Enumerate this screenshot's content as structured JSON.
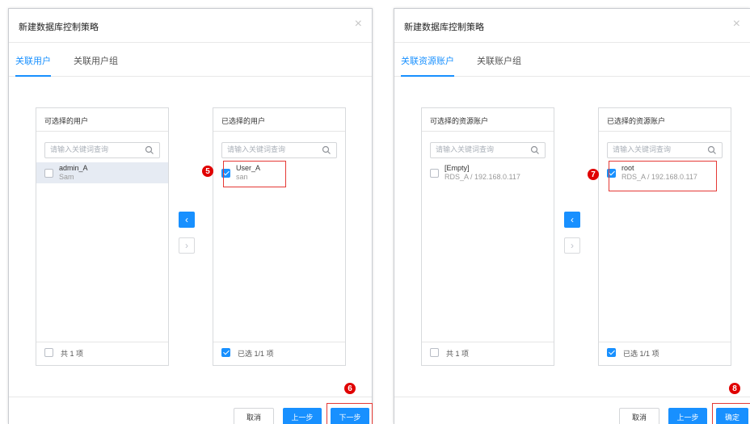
{
  "dialogs": [
    {
      "title": "新建数据库控制策略",
      "close_symbol": "×",
      "tabs": [
        {
          "label": "关联用户",
          "active": true
        },
        {
          "label": "关联用户组",
          "active": false
        }
      ],
      "source_panel": {
        "title": "可选择的用户",
        "search_placeholder": "请输入关键词查询",
        "items": [
          {
            "name": "admin_A",
            "sub": "Sam",
            "checked": false
          }
        ],
        "footer": "共 1 项"
      },
      "target_panel": {
        "title": "已选择的用户",
        "search_placeholder": "请输入关键词查询",
        "items": [
          {
            "name": "User_A",
            "sub": "san",
            "checked": true
          }
        ],
        "footer": "已选 1/1 项"
      },
      "transfer_buttons": {
        "left": "‹",
        "right": "›"
      },
      "step_markers": [
        "5",
        "6"
      ],
      "buttons": {
        "cancel": "取消",
        "prev": "上一步",
        "next": "下一步"
      }
    },
    {
      "title": "新建数据库控制策略",
      "close_symbol": "×",
      "tabs": [
        {
          "label": "关联资源账户",
          "active": true
        },
        {
          "label": "关联账户组",
          "active": false
        }
      ],
      "source_panel": {
        "title": "可选择的资源账户",
        "search_placeholder": "请输入关键词查询",
        "items": [
          {
            "name": "[Empty]",
            "sub": "RDS_A / 192.168.0.117",
            "checked": false
          }
        ],
        "footer": "共 1 项"
      },
      "target_panel": {
        "title": "已选择的资源账户",
        "search_placeholder": "请输入关键词查询",
        "items": [
          {
            "name": "root",
            "sub": "RDS_A / 192.168.0.117",
            "checked": true
          }
        ],
        "footer": "已选 1/1 项"
      },
      "transfer_buttons": {
        "left": "‹",
        "right": "›"
      },
      "step_markers": [
        "7",
        "8"
      ],
      "buttons": {
        "cancel": "取消",
        "prev": "上一步",
        "confirm": "确定"
      }
    }
  ],
  "colors": {
    "accent": "#1890ff",
    "marker": "#e00000",
    "highlight_border": "#e53935"
  }
}
